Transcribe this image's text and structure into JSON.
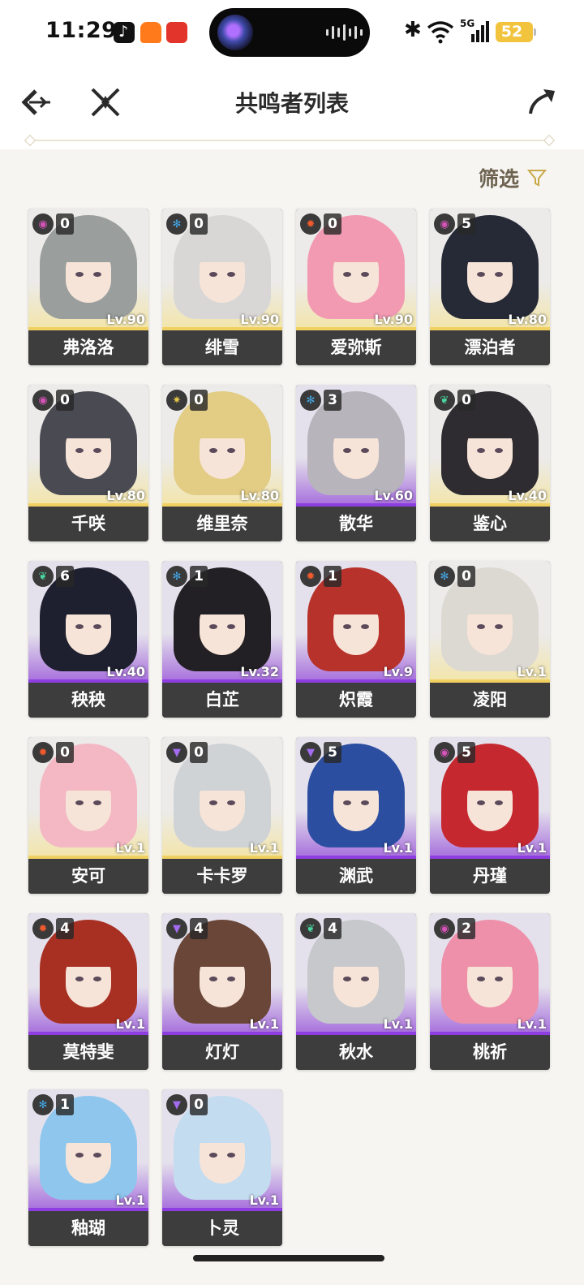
{
  "status_bar": {
    "time": "11:29",
    "network": "5G",
    "battery": "52"
  },
  "header": {
    "title": "共鸣者列表",
    "back_icon": "back-arrow-icon",
    "close_icon": "close-icon",
    "share_icon": "share-icon"
  },
  "filter": {
    "label": "筛选",
    "icon": "filter-icon"
  },
  "element_colors": {
    "havoc": "#d453b7",
    "glacio": "#43a8e8",
    "fusion": "#f05a2e",
    "spectro": "#e8c84a",
    "aero": "#4ad6a0",
    "electro": "#a36cf0"
  },
  "characters": [
    {
      "name": "弗洛洛",
      "chain": "0",
      "level": "Lv.90",
      "element": "havoc",
      "rarity": "gold"
    },
    {
      "name": "绯雪",
      "chain": "0",
      "level": "Lv.90",
      "element": "glacio",
      "rarity": "gold"
    },
    {
      "name": "爱弥斯",
      "chain": "0",
      "level": "Lv.90",
      "element": "fusion",
      "rarity": "gold"
    },
    {
      "name": "漂泊者",
      "chain": "5",
      "level": "Lv.80",
      "element": "havoc",
      "rarity": "gold"
    },
    {
      "name": "千咲",
      "chain": "0",
      "level": "Lv.80",
      "element": "havoc",
      "rarity": "gold"
    },
    {
      "name": "维里奈",
      "chain": "0",
      "level": "Lv.80",
      "element": "spectro",
      "rarity": "gold"
    },
    {
      "name": "散华",
      "chain": "3",
      "level": "Lv.60",
      "element": "glacio",
      "rarity": "purple"
    },
    {
      "name": "鉴心",
      "chain": "0",
      "level": "Lv.40",
      "element": "aero",
      "rarity": "gold"
    },
    {
      "name": "秧秧",
      "chain": "6",
      "level": "Lv.40",
      "element": "aero",
      "rarity": "purple"
    },
    {
      "name": "白芷",
      "chain": "1",
      "level": "Lv.32",
      "element": "glacio",
      "rarity": "purple"
    },
    {
      "name": "炽霞",
      "chain": "1",
      "level": "Lv.9",
      "element": "fusion",
      "rarity": "purple"
    },
    {
      "name": "凌阳",
      "chain": "0",
      "level": "Lv.1",
      "element": "glacio",
      "rarity": "gold"
    },
    {
      "name": "安可",
      "chain": "0",
      "level": "Lv.1",
      "element": "fusion",
      "rarity": "gold"
    },
    {
      "name": "卡卡罗",
      "chain": "0",
      "level": "Lv.1",
      "element": "electro",
      "rarity": "gold"
    },
    {
      "name": "渊武",
      "chain": "5",
      "level": "Lv.1",
      "element": "electro",
      "rarity": "purple"
    },
    {
      "name": "丹瑾",
      "chain": "5",
      "level": "Lv.1",
      "element": "havoc",
      "rarity": "purple"
    },
    {
      "name": "莫特斐",
      "chain": "4",
      "level": "Lv.1",
      "element": "fusion",
      "rarity": "purple"
    },
    {
      "name": "灯灯",
      "chain": "4",
      "level": "Lv.1",
      "element": "electro",
      "rarity": "purple"
    },
    {
      "name": "秋水",
      "chain": "4",
      "level": "Lv.1",
      "element": "aero",
      "rarity": "purple"
    },
    {
      "name": "桃祈",
      "chain": "2",
      "level": "Lv.1",
      "element": "havoc",
      "rarity": "purple"
    },
    {
      "name": "釉瑚",
      "chain": "1",
      "level": "Lv.1",
      "element": "glacio",
      "rarity": "purple"
    },
    {
      "name": "卜灵",
      "chain": "0",
      "level": "Lv.1",
      "element": "electro",
      "rarity": "purple"
    }
  ]
}
